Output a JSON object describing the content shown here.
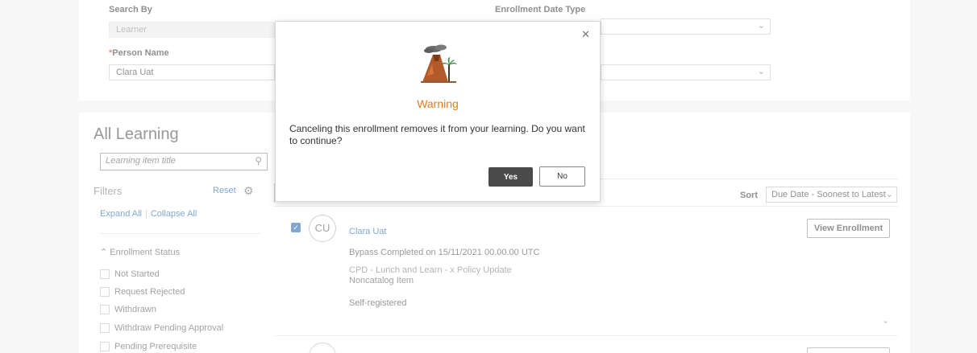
{
  "search": {
    "search_by_label": "Search By",
    "search_by_value": "Learner",
    "person_name_required": "*",
    "person_name_label": "Person Name",
    "person_name_value": "Clara Uat",
    "enrollment_date_type_label": "Enrollment Date Type"
  },
  "sidebar": {
    "title": "All Learning",
    "search_placeholder": "Learning item title",
    "filters_label": "Filters",
    "reset_label": "Reset",
    "expand_all": "Expand All",
    "collapse_all": "Collapse All",
    "enrollment_status_label": "Enrollment Status",
    "status_options": [
      "Not Started",
      "Request Rejected",
      "Withdrawn",
      "Withdraw Pending Approval",
      "Pending Prerequisite"
    ]
  },
  "list": {
    "sort_label": "Sort",
    "sort_value": "Due Date - Soonest to Latest",
    "rows": [
      {
        "initials": "CU",
        "name": "Clara Uat",
        "status": "Bypass Completed on 15/11/2021 00.00.00 UTC",
        "course": "CPD - Lunch and Learn - x Policy Update",
        "type": "Noncatalog Item",
        "registration": "Self-registered",
        "action": "View Enrollment",
        "selected": true
      }
    ]
  },
  "dialog": {
    "title": "Warning",
    "message": "Canceling this enrollment removes it from your learning. Do you want to continue?",
    "yes_label": "Yes",
    "no_label": "No",
    "title_color": "#e07b22"
  }
}
